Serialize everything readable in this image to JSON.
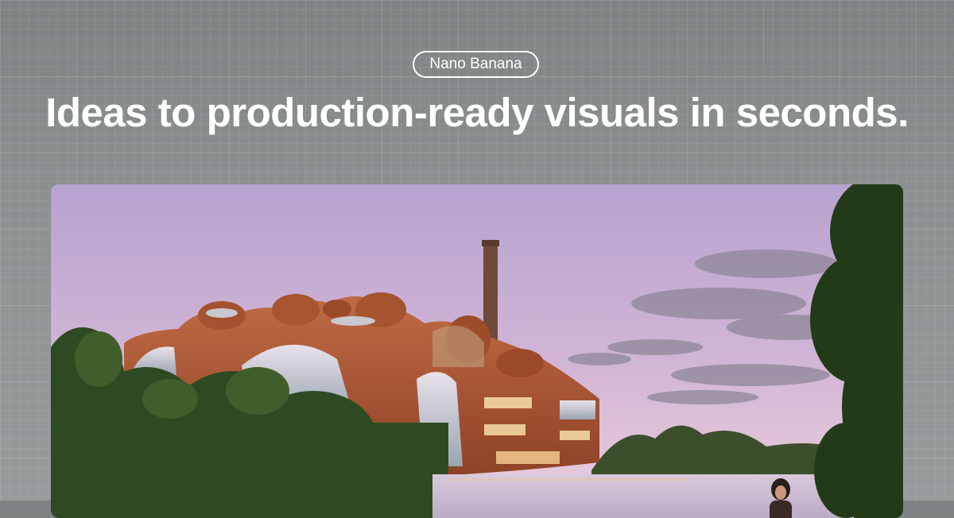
{
  "badge": {
    "label": "Nano Banana"
  },
  "headline": {
    "text": "Ideas to production-ready visuals in seconds."
  },
  "hero": {
    "subject": "organic copper-clad factory building beside a river at dusk"
  },
  "colors": {
    "background": "#8a8f90",
    "text": "#ffffff",
    "sky_top": "#b9a3cf",
    "sky_bottom": "#e6c5da",
    "building": "#b25a3a",
    "foliage": "#2f4a22",
    "water": "#c9bcd6"
  }
}
